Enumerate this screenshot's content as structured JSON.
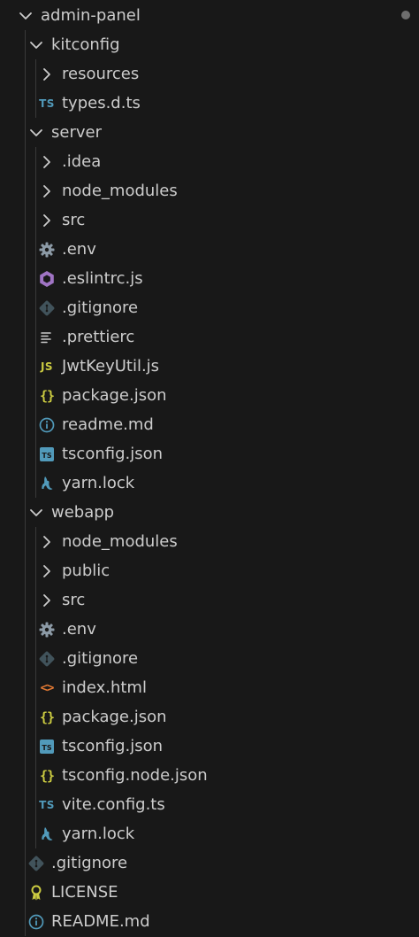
{
  "explorer": {
    "modified_indicator": "modified-dot",
    "items": [
      {
        "label": "admin-panel",
        "type": "folder",
        "expanded": true,
        "depth": 0,
        "icon": "chevron-down-icon"
      },
      {
        "label": "kitconfig",
        "type": "folder",
        "expanded": true,
        "depth": 1,
        "icon": "chevron-down-icon"
      },
      {
        "label": "resources",
        "type": "folder",
        "expanded": false,
        "depth": 2,
        "icon": "chevron-right-icon"
      },
      {
        "label": "types.d.ts",
        "type": "file",
        "depth": 2,
        "icon": "typescript-icon"
      },
      {
        "label": "server",
        "type": "folder",
        "expanded": true,
        "depth": 1,
        "icon": "chevron-down-icon"
      },
      {
        "label": ".idea",
        "type": "folder",
        "expanded": false,
        "depth": 2,
        "icon": "chevron-right-icon"
      },
      {
        "label": "node_modules",
        "type": "folder",
        "expanded": false,
        "depth": 2,
        "icon": "chevron-right-icon"
      },
      {
        "label": "src",
        "type": "folder",
        "expanded": false,
        "depth": 2,
        "icon": "chevron-right-icon"
      },
      {
        "label": ".env",
        "type": "file",
        "depth": 2,
        "icon": "gear-icon"
      },
      {
        "label": ".eslintrc.js",
        "type": "file",
        "depth": 2,
        "icon": "eslint-icon"
      },
      {
        "label": ".gitignore",
        "type": "file",
        "depth": 2,
        "icon": "git-icon"
      },
      {
        "label": ".prettierc",
        "type": "file",
        "depth": 2,
        "icon": "lines-icon"
      },
      {
        "label": "JwtKeyUtil.js",
        "type": "file",
        "depth": 2,
        "icon": "javascript-icon"
      },
      {
        "label": "package.json",
        "type": "file",
        "depth": 2,
        "icon": "json-icon"
      },
      {
        "label": "readme.md",
        "type": "file",
        "depth": 2,
        "icon": "info-icon"
      },
      {
        "label": "tsconfig.json",
        "type": "file",
        "depth": 2,
        "icon": "tsconfig-icon"
      },
      {
        "label": "yarn.lock",
        "type": "file",
        "depth": 2,
        "icon": "yarn-icon"
      },
      {
        "label": "webapp",
        "type": "folder",
        "expanded": true,
        "depth": 1,
        "icon": "chevron-down-icon"
      },
      {
        "label": "node_modules",
        "type": "folder",
        "expanded": false,
        "depth": 2,
        "icon": "chevron-right-icon"
      },
      {
        "label": "public",
        "type": "folder",
        "expanded": false,
        "depth": 2,
        "icon": "chevron-right-icon"
      },
      {
        "label": "src",
        "type": "folder",
        "expanded": false,
        "depth": 2,
        "icon": "chevron-right-icon"
      },
      {
        "label": ".env",
        "type": "file",
        "depth": 2,
        "icon": "gear-icon"
      },
      {
        "label": ".gitignore",
        "type": "file",
        "depth": 2,
        "icon": "git-icon"
      },
      {
        "label": "index.html",
        "type": "file",
        "depth": 2,
        "icon": "html-icon"
      },
      {
        "label": "package.json",
        "type": "file",
        "depth": 2,
        "icon": "json-icon"
      },
      {
        "label": "tsconfig.json",
        "type": "file",
        "depth": 2,
        "icon": "tsconfig-icon"
      },
      {
        "label": "tsconfig.node.json",
        "type": "file",
        "depth": 2,
        "icon": "json-icon"
      },
      {
        "label": "vite.config.ts",
        "type": "file",
        "depth": 2,
        "icon": "typescript-icon"
      },
      {
        "label": "yarn.lock",
        "type": "file",
        "depth": 2,
        "icon": "yarn-icon"
      },
      {
        "label": ".gitignore",
        "type": "file",
        "depth": 1,
        "icon": "git-icon"
      },
      {
        "label": "LICENSE",
        "type": "file",
        "depth": 1,
        "icon": "license-icon"
      },
      {
        "label": "README.md",
        "type": "file",
        "depth": 1,
        "icon": "info-icon"
      }
    ]
  },
  "colors": {
    "background": "#181818",
    "text": "#cccccc",
    "chevron": "#cccccc",
    "guide": "#3a3a3a",
    "typescript": "#519aba",
    "javascript": "#cbcb41",
    "json": "#cbcb41",
    "html": "#e37933",
    "eslint": "#a074c4",
    "gear": "#8c9aa6",
    "git": "#41535b",
    "info": "#519aba",
    "yarn": "#519aba",
    "license": "#cbcb41"
  }
}
